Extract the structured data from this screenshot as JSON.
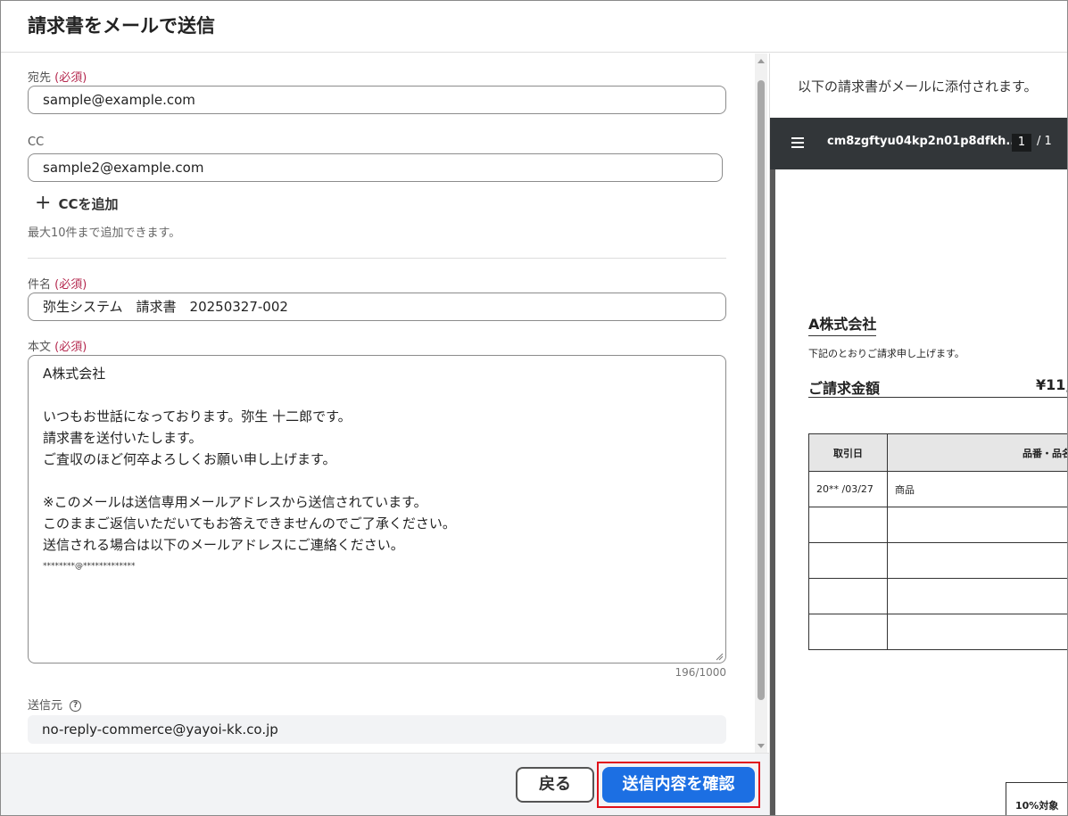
{
  "dialog": {
    "title": "請求書をメールで送信"
  },
  "form": {
    "to": {
      "label": "宛先",
      "required": "(必須)",
      "value": "sample@example.com"
    },
    "cc": {
      "label": "CC",
      "value": "sample2@example.com"
    },
    "add_cc": {
      "label": "CCを追加",
      "hint": "最大10件まで追加できます。"
    },
    "subject": {
      "label": "件名",
      "required": "(必須)",
      "value": "弥生システム　請求書　20250327-002"
    },
    "body": {
      "label": "本文",
      "required": "(必須)",
      "lines": [
        "A株式会社",
        "",
        "いつもお世話になっております。弥生 十二郎です。",
        "請求書を送付いたします。",
        "ご査収のほど何卒よろしくお願い申し上げます。",
        "",
        "※このメールは送信専用メールアドレスから送信されています。",
        "このままご返信いただいてもお答えできませんのでご了承ください。",
        "送信される場合は以下のメールアドレスにご連絡ください。",
        "********@*************"
      ],
      "counter": "196/1000"
    },
    "sender": {
      "label": "送信元",
      "value": "no-reply-commerce@yayoi-kk.co.jp"
    }
  },
  "footer": {
    "back_label": "戻る",
    "confirm_label": "送信内容を確認"
  },
  "preview": {
    "note": "以下の請求書がメールに添付されます。",
    "viewer": {
      "filename": "cm8zgftyu04kp2n01p8dfkh...",
      "page": "1",
      "total": "/  1"
    },
    "document": {
      "company": "A株式会社",
      "intro": "下記のとおりご請求申し上げます。",
      "amount_label": "ご請求金額",
      "amount_value": "¥11,",
      "table": {
        "headers": [
          "取引日",
          "品番・品名"
        ],
        "rows": [
          [
            "20** /03/27",
            "商品"
          ],
          [
            "",
            ""
          ],
          [
            "",
            ""
          ],
          [
            "",
            ""
          ],
          [
            "",
            ""
          ]
        ]
      },
      "tax_label": "10%対象"
    }
  },
  "colors": {
    "accent": "#1c6fe3",
    "required": "#b5294f",
    "highlight": "#e0101a"
  }
}
